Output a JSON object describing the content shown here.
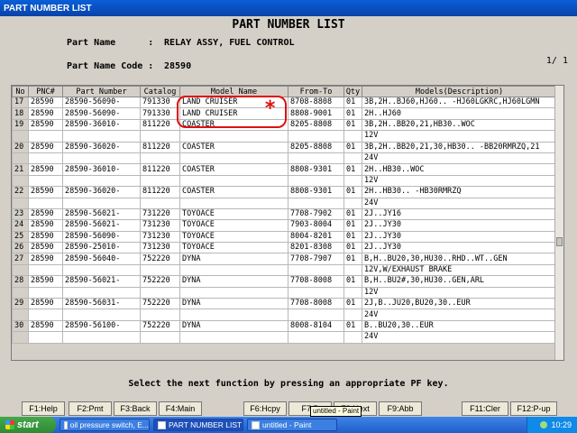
{
  "window": {
    "title": "PART NUMBER LIST"
  },
  "header": {
    "title": "PART NUMBER LIST",
    "part_name_label": "Part Name      :",
    "part_name": "RELAY ASSY, FUEL CONTROL",
    "part_code_label": "Part Name Code :",
    "part_code": "28590",
    "page": "1/ 1"
  },
  "table": {
    "columns": [
      "No",
      "PNC#",
      "Part Number",
      "Catalog",
      "Model Name",
      "From-To",
      "Qty",
      "Models(Description)"
    ],
    "rows": [
      [
        "17",
        "28590",
        "28590-56090-",
        "791330",
        "LAND CRUISER",
        "8708-8808",
        "01",
        "3B,2H..BJ60,HJ60.. -HJ60LGKRC,HJ60LGMN"
      ],
      [
        "18",
        "28590",
        "28590-56090-",
        "791330",
        "LAND CRUISER",
        "8808-9001",
        "01",
        "2H..HJ60"
      ],
      [
        "19",
        "28590",
        "28590-36010-",
        "811220",
        "COASTER",
        "8205-8808",
        "01",
        "3B,2H..BB20,21,HB30..WOC"
      ],
      [
        "",
        "",
        "",
        "",
        "",
        "",
        "",
        "12V"
      ],
      [
        "20",
        "28590",
        "28590-36020-",
        "811220",
        "COASTER",
        "8205-8808",
        "01",
        "3B,2H..BB20,21,30,HB30.. -BB20RMRZQ,21"
      ],
      [
        "",
        "",
        "",
        "",
        "",
        "",
        "",
        "24V"
      ],
      [
        "21",
        "28590",
        "28590-36010-",
        "811220",
        "COASTER",
        "8808-9301",
        "01",
        "2H..HB30..WOC"
      ],
      [
        "",
        "",
        "",
        "",
        "",
        "",
        "",
        "12V"
      ],
      [
        "22",
        "28590",
        "28590-36020-",
        "811220",
        "COASTER",
        "8808-9301",
        "01",
        "2H..HB30.. -HB30RMRZQ"
      ],
      [
        "",
        "",
        "",
        "",
        "",
        "",
        "",
        "24V"
      ],
      [
        "23",
        "28590",
        "28590-56021-",
        "731220",
        "TOYOACE",
        "7708-7902",
        "01",
        "2J..JY16"
      ],
      [
        "24",
        "28590",
        "28590-56021-",
        "731230",
        "TOYOACE",
        "7903-8004",
        "01",
        "2J..JY30"
      ],
      [
        "25",
        "28590",
        "28590-56090-",
        "731230",
        "TOYOACE",
        "8004-8201",
        "01",
        "2J..JY30"
      ],
      [
        "26",
        "28590",
        "28590-25010-",
        "731230",
        "TOYOACE",
        "8201-8308",
        "01",
        "2J..JY30"
      ],
      [
        "27",
        "28590",
        "28590-56040-",
        "752220",
        "DYNA",
        "7708-7907",
        "01",
        "B,H..BU20,30,HU30..RHD..WT..GEN"
      ],
      [
        "",
        "",
        "",
        "",
        "",
        "",
        "",
        "12V,W/EXHAUST BRAKE"
      ],
      [
        "28",
        "28590",
        "28590-56021-",
        "752220",
        "DYNA",
        "7708-8008",
        "01",
        "B,H..BU2#,30,HU30..GEN,ARL"
      ],
      [
        "",
        "",
        "",
        "",
        "",
        "",
        "",
        "12V"
      ],
      [
        "29",
        "28590",
        "28590-56031-",
        "752220",
        "DYNA",
        "7708-8008",
        "01",
        "2J,B..JU20,BU20,30..EUR"
      ],
      [
        "",
        "",
        "",
        "",
        "",
        "",
        "",
        "24V"
      ],
      [
        "30",
        "28590",
        "28590-56100-",
        "752220",
        "DYNA",
        "8008-8104",
        "01",
        "B..BU20,30..EUR"
      ],
      [
        "",
        "",
        "",
        "",
        "",
        "",
        "",
        "24V"
      ]
    ]
  },
  "instruction": "Select the next function by pressing an appropriate PF key.",
  "fkeys": [
    {
      "id": "f1",
      "label": "F1:Help"
    },
    {
      "id": "f2",
      "label": "F2:Pmt"
    },
    {
      "id": "f3",
      "label": "F3:Back"
    },
    {
      "id": "f4",
      "label": "F4:Main"
    },
    {
      "id": "f6",
      "label": "F6:Hcpy"
    },
    {
      "id": "f7",
      "label": "F7:P"
    },
    {
      "id": "f8",
      "label": "F8:Next"
    },
    {
      "id": "f9",
      "label": "F9:Abb"
    },
    {
      "id": "f11",
      "label": "F11:Cler"
    },
    {
      "id": "f12",
      "label": "F12:P-up"
    }
  ],
  "tooltip": "untitled - Paint",
  "annotation": {
    "mark": "*",
    "color": "#e01010"
  },
  "taskbar": {
    "start": "start",
    "tasks": [
      "oil pressure switch, E...",
      "PART NUMBER LIST",
      "untitled - Paint"
    ],
    "clock": "10:29"
  }
}
